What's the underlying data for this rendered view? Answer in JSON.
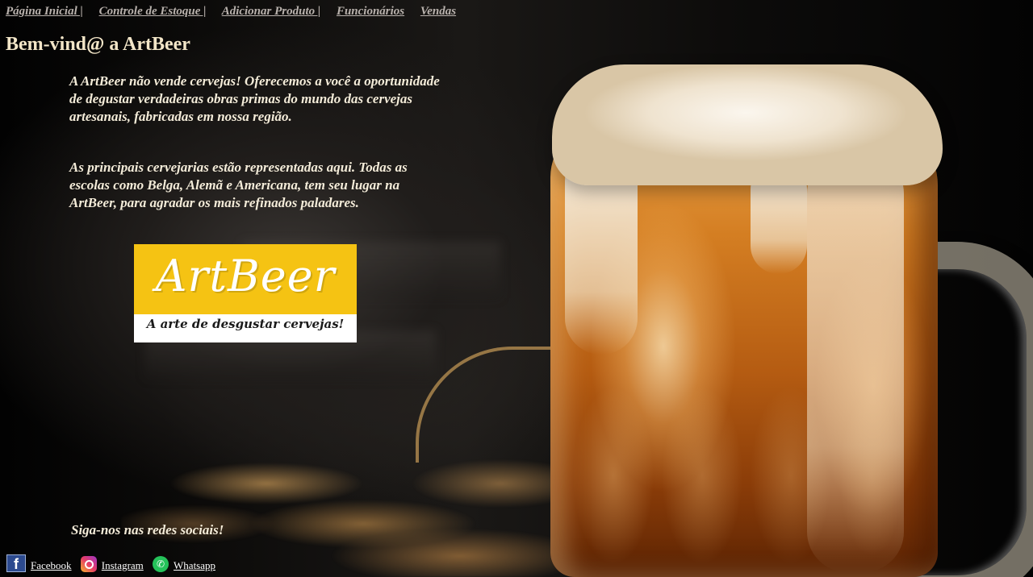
{
  "nav": {
    "items": [
      {
        "label": "Página Inicial |"
      },
      {
        "label": "Controle de Estoque |"
      },
      {
        "label": "Adicionar Produto |"
      },
      {
        "label": "Funcionários"
      },
      {
        "label": "Vendas"
      }
    ]
  },
  "main": {
    "title": "Bem-vind@ a ArtBeer",
    "paragraphs": [
      "A ArtBeer não vende cervejas! Oferecemos a você a oportunidade de degustar verdadeiras obras primas do mundo das cervejas artesanais, fabricadas em nossa região.",
      "As principais cervejarias estão representadas aqui. Todas as escolas como Belga, Alemã e Americana, tem seu lugar na ArtBeer, para agradar os mais refinados paladares."
    ],
    "logo": {
      "wordmark": "ArtBeer",
      "tagline": "A arte de desgustar cervejas!"
    }
  },
  "social": {
    "heading": "Siga-nos nas redes sociais!",
    "links": [
      {
        "label": "Facebook",
        "icon": "facebook-icon"
      },
      {
        "label": "Instagram",
        "icon": "instagram-icon"
      },
      {
        "label": "Whatsapp",
        "icon": "whatsapp-icon"
      }
    ]
  },
  "colors": {
    "logo_yellow": "#f5c313",
    "nav_link": "#b9b2ad",
    "body_text": "#f4ecd9"
  }
}
